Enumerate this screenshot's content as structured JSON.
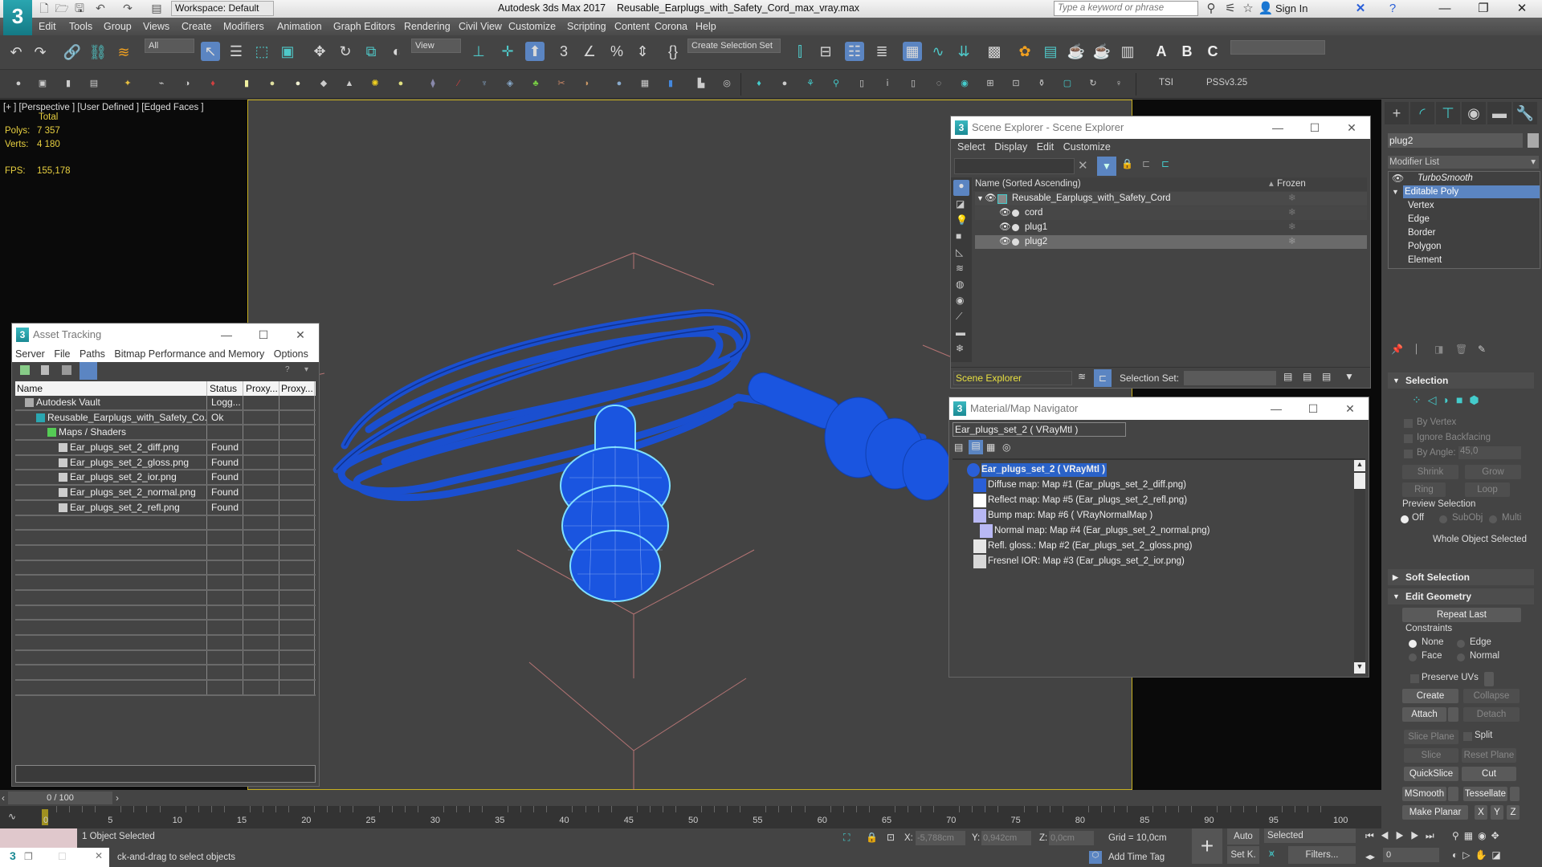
{
  "app": {
    "title": "Autodesk 3ds Max 2017",
    "file": "Reusable_Earplugs_with_Safety_Cord_max_vray.max",
    "workspace": "Workspace: Default",
    "search_placeholder": "Type a keyword or phrase",
    "sign_in": "Sign In",
    "logo_text": "3"
  },
  "menu": [
    "Edit",
    "Tools",
    "Group",
    "Views",
    "Create",
    "Modifiers",
    "Animation",
    "Graph Editors",
    "Rendering",
    "Civil View",
    "Customize",
    "Scripting",
    "Content",
    "Corona",
    "Help"
  ],
  "toolbar": {
    "selection_filter": "All",
    "ref_coord": "View",
    "named_selection": "Create Selection Set",
    "tsi": "TSI",
    "pss": "PSSv3.25"
  },
  "viewport": {
    "label": "[+ ] [Perspective ]  [User Defined ] [Edged Faces ]",
    "stats_title": "Total",
    "polys_label": "Polys:",
    "polys_value": "7 357",
    "verts_label": "Verts:",
    "verts_value": "4 180",
    "fps_label": "FPS:",
    "fps_value": "155,178"
  },
  "asset_tracking": {
    "title": "Asset Tracking",
    "menu": [
      "Server",
      "File",
      "Paths",
      "Bitmap Performance and Memory",
      "Options"
    ],
    "columns": [
      "Name",
      "Status",
      "Proxy...",
      "Proxy..."
    ],
    "rows": [
      {
        "name": "Autodesk Vault",
        "status": "Logg...",
        "indent": 0
      },
      {
        "name": "Reusable_Earplugs_with_Safety_Co...",
        "status": "Ok",
        "indent": 1
      },
      {
        "name": "Maps / Shaders",
        "status": "",
        "indent": 2
      },
      {
        "name": "Ear_plugs_set_2_diff.png",
        "status": "Found",
        "indent": 3
      },
      {
        "name": "Ear_plugs_set_2_gloss.png",
        "status": "Found",
        "indent": 3
      },
      {
        "name": "Ear_plugs_set_2_ior.png",
        "status": "Found",
        "indent": 3
      },
      {
        "name": "Ear_plugs_set_2_normal.png",
        "status": "Found",
        "indent": 3
      },
      {
        "name": "Ear_plugs_set_2_refl.png",
        "status": "Found",
        "indent": 3
      }
    ]
  },
  "scene_explorer": {
    "title": "Scene Explorer - Scene Explorer",
    "menu": [
      "Select",
      "Display",
      "Edit",
      "Customize"
    ],
    "col_name": "Name (Sorted Ascending)",
    "col_frozen": "Frozen",
    "rows": [
      "Reusable_Earplugs_with_Safety_Cord",
      "cord",
      "plug1",
      "plug2"
    ],
    "selected": "plug2",
    "footer_dropdown": "Scene Explorer",
    "selection_set_label": "Selection Set:"
  },
  "material_navigator": {
    "title": "Material/Map Navigator",
    "current": "Ear_plugs_set_2  ( VRayMtl )",
    "items": [
      {
        "label": "Ear_plugs_set_2  ( VRayMtl )",
        "color": "#2a5fd8",
        "level": 0
      },
      {
        "label": "Diffuse map: Map #1 (Ear_plugs_set_2_diff.png)",
        "color": "#2a5fd8",
        "level": 1
      },
      {
        "label": "Reflect map: Map #5 (Ear_plugs_set_2_refl.png)",
        "color": "#ffffff",
        "level": 1
      },
      {
        "label": "Bump map: Map #6  ( VRayNormalMap )",
        "color": "#b8b8f4",
        "level": 1
      },
      {
        "label": "Normal map: Map #4 (Ear_plugs_set_2_normal.png)",
        "color": "#b8b8f4",
        "level": 2
      },
      {
        "label": "Refl. gloss.: Map #2 (Ear_plugs_set_2_gloss.png)",
        "color": "#e6e6e6",
        "level": 1
      },
      {
        "label": "Fresnel IOR: Map #3 (Ear_plugs_set_2_ior.png)",
        "color": "#d8d8d8",
        "level": 1
      }
    ]
  },
  "command_panel": {
    "object_name": "plug2",
    "modifier_list": "Modifier List",
    "stack": [
      {
        "label": "TurboSmooth",
        "type": "modifier"
      },
      {
        "label": "Editable Poly",
        "type": "base",
        "selected": true
      },
      {
        "label": "Vertex",
        "type": "sub"
      },
      {
        "label": "Edge",
        "type": "sub"
      },
      {
        "label": "Border",
        "type": "sub"
      },
      {
        "label": "Polygon",
        "type": "sub"
      },
      {
        "label": "Element",
        "type": "sub"
      }
    ],
    "selection": {
      "title": "Selection",
      "by_vertex": "By Vertex",
      "ignore_backfacing": "Ignore Backfacing",
      "by_angle": "By Angle:",
      "angle_value": "45,0",
      "shrink": "Shrink",
      "grow": "Grow",
      "ring": "Ring",
      "loop": "Loop",
      "preview_title": "Preview Selection",
      "preview_options": [
        "Off",
        "SubObj",
        "Multi"
      ],
      "preview_selected": "Off",
      "status": "Whole Object Selected"
    },
    "soft_selection": "Soft Selection",
    "edit_geometry": {
      "title": "Edit Geometry",
      "repeat_last": "Repeat Last",
      "constraints_title": "Constraints",
      "constraints": [
        "None",
        "Edge",
        "Face",
        "Normal"
      ],
      "constraint_selected": "None",
      "preserve_uvs": "Preserve UVs",
      "create": "Create",
      "collapse": "Collapse",
      "attach": "Attach",
      "detach": "Detach",
      "slice_plane": "Slice Plane",
      "split": "Split",
      "slice": "Slice",
      "reset_plane": "Reset Plane",
      "quickslice": "QuickSlice",
      "cut": "Cut",
      "msmooth": "MSmooth",
      "tessellate": "Tessellate",
      "make_planar": "Make Planar",
      "x": "X",
      "y": "Y",
      "z": "Z"
    }
  },
  "timeline": {
    "frame": "0 / 100",
    "ticks": [
      "0",
      "5",
      "10",
      "15",
      "20",
      "25",
      "30",
      "35",
      "40",
      "45",
      "50",
      "55",
      "60",
      "65",
      "70",
      "75",
      "80",
      "85",
      "90",
      "95",
      "100"
    ]
  },
  "status": {
    "selected": "1 Object Selected",
    "prompt": "ck-and-drag to select objects",
    "x_label": "X:",
    "x_value": "-5,788cm",
    "y_label": "Y:",
    "y_value": "0,942cm",
    "z_label": "Z:",
    "z_value": "0,0cm",
    "grid": "Grid = 10,0cm",
    "add_time_tag": "Add Time Tag",
    "auto": "Auto",
    "set_key": "Set K.",
    "key_filter": "Selected",
    "filters": "Filters...",
    "current_frame": "0"
  }
}
